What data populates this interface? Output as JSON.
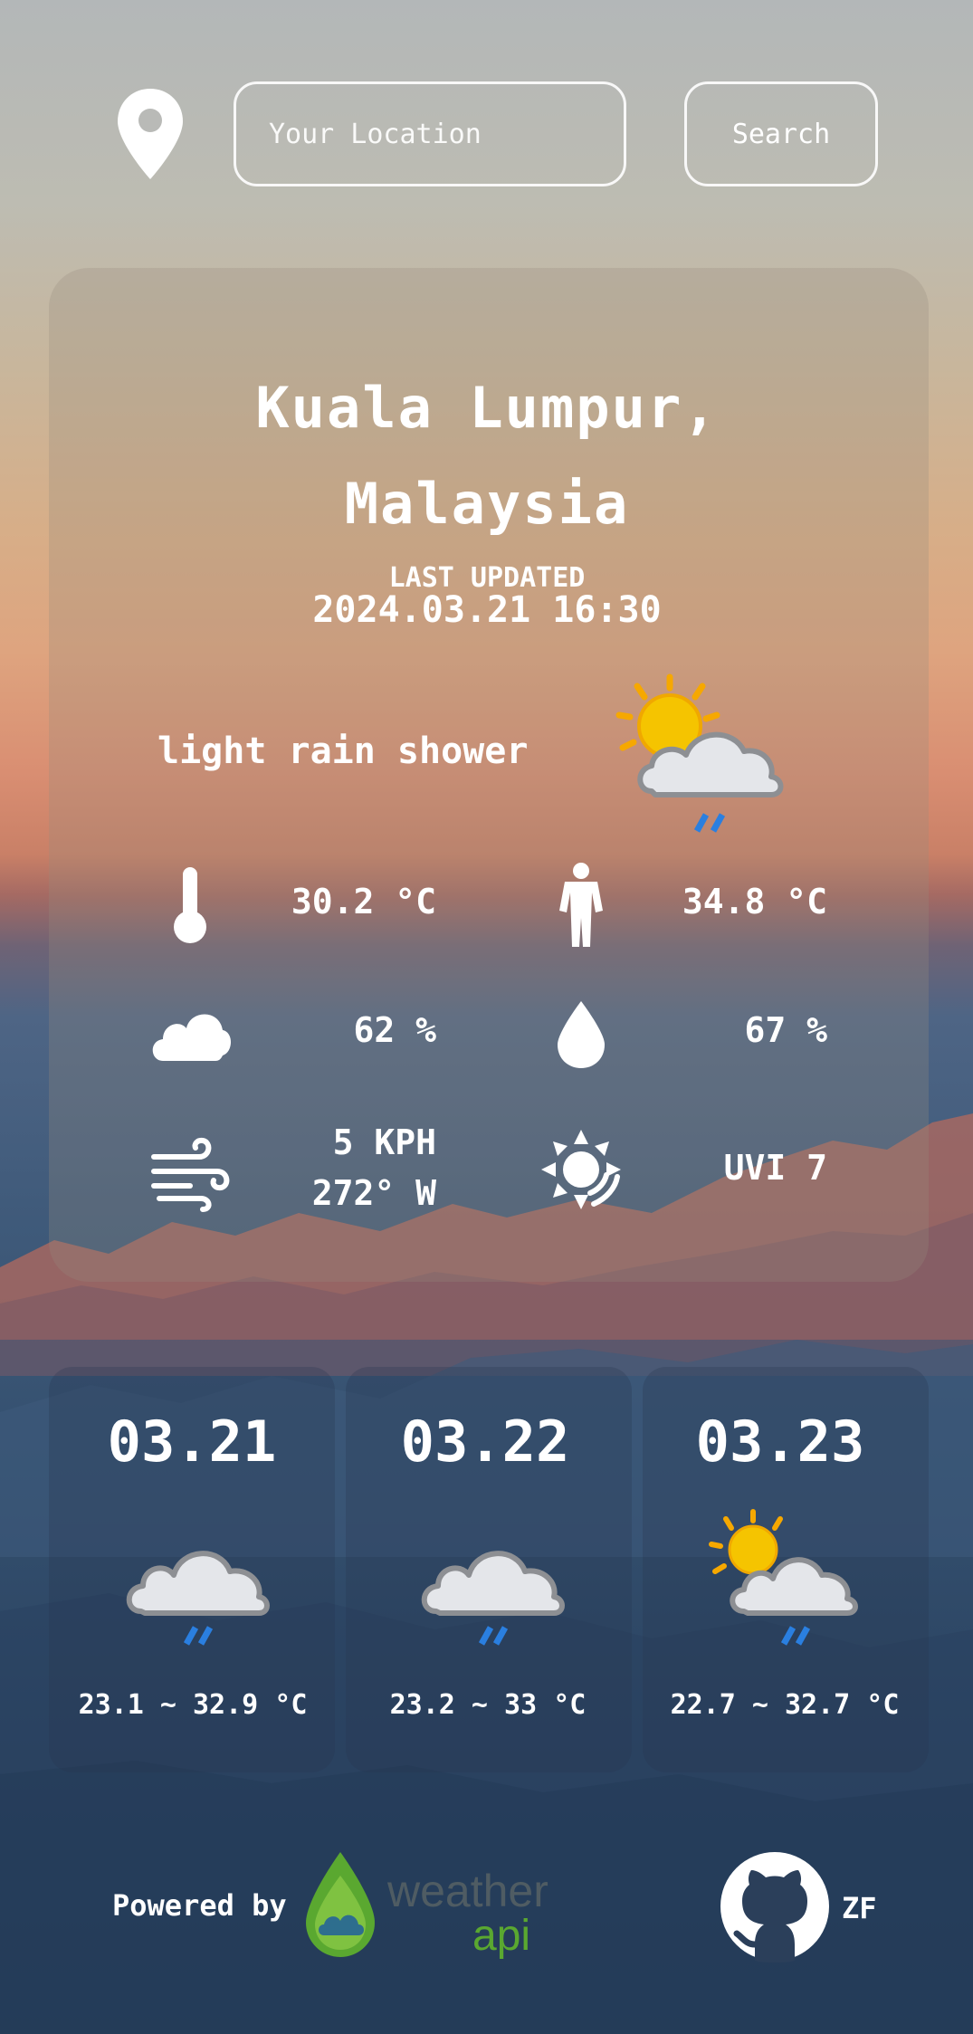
{
  "search": {
    "placeholder": "Your Location",
    "button_label": "Search"
  },
  "current": {
    "city": "Kuala Lumpur, Malaysia",
    "updated_label": "LAST UPDATED",
    "updated_time": "2024.03.21 16:30",
    "condition": "light rain shower",
    "condition_icon": "sun-cloud-rain-icon",
    "temperature": "30.2 °C",
    "feels_like": "34.8 °C",
    "cloud": "62 %",
    "humidity": "67 %",
    "wind_speed": "5 KPH",
    "wind_dir": "272° W",
    "uv": "UVI 7"
  },
  "forecast": [
    {
      "date": "03.21",
      "temp": "23.1 ~ 32.9 °C",
      "icon": "cloud-rain-icon"
    },
    {
      "date": "03.22",
      "temp": "23.2 ~ 33 °C",
      "icon": "cloud-rain-icon"
    },
    {
      "date": "03.23",
      "temp": "22.7 ~ 32.7 °C",
      "icon": "sun-cloud-rain-icon"
    }
  ],
  "footer": {
    "powered_by": "Powered by",
    "logo_word1": "weather",
    "logo_word2": "api",
    "github_user": "ZF"
  },
  "colors": {
    "rain": "#2a7fe0",
    "sun": "#f5c400",
    "sun_ray": "#f6a800",
    "cloud": "#e4e6ea",
    "logo_green": "#5aa830"
  }
}
